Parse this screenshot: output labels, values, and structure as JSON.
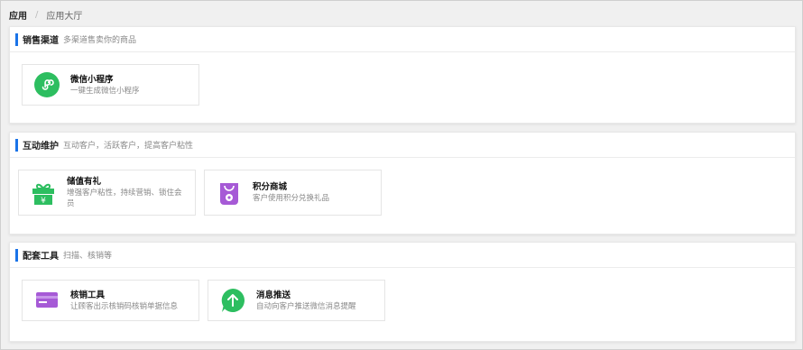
{
  "breadcrumb": {
    "home": "应用",
    "separator": "/",
    "current": "应用大厅"
  },
  "sections": [
    {
      "title": "销售渠道",
      "desc": "多渠道售卖你的商品",
      "cards": [
        {
          "name": "微信小程序",
          "sub": "一键生成微信小程序",
          "icon": "mini-program-icon",
          "color": "#2dbe60"
        }
      ]
    },
    {
      "title": "互动维护",
      "desc": "互动客户，活跃客户，提高客户粘性",
      "cards": [
        {
          "name": "储值有礼",
          "sub": "增强客户粘性，持续营销、锁住会员",
          "icon": "gift-icon",
          "color": "#2dbe60"
        },
        {
          "name": "积分商城",
          "sub": "客户使用积分兑换礼品",
          "icon": "points-bag-icon",
          "color": "#a65ad6"
        }
      ]
    },
    {
      "title": "配套工具",
      "desc": "扫描、核销等",
      "cards": [
        {
          "name": "核销工具",
          "sub": "让顾客出示核销码核销单据信息",
          "icon": "card-icon",
          "color": "#a65ad6"
        },
        {
          "name": "消息推送",
          "sub": "自动向客户推送微信消息提醒",
          "icon": "push-message-icon",
          "color": "#2dbe60"
        }
      ]
    }
  ],
  "colors": {
    "accent_bar": "#1a73e8",
    "green": "#2dbe60",
    "purple": "#a65ad6"
  }
}
